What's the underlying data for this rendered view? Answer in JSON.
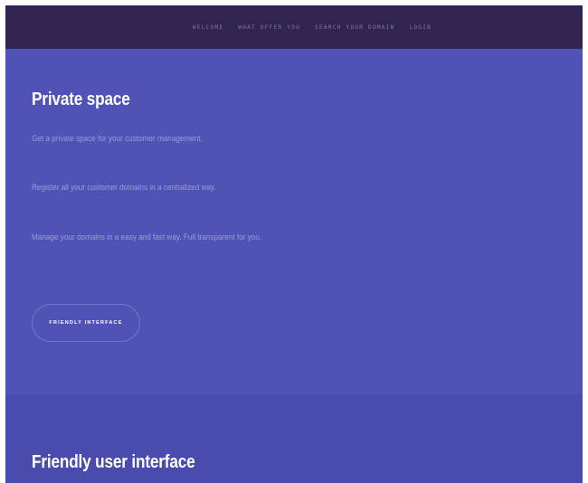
{
  "nav": {
    "items": [
      {
        "label": "WELCOME"
      },
      {
        "label": "WHAT OFFER YOU"
      },
      {
        "label": "SEARCH YOUR DOMAIN"
      },
      {
        "label": "LOGIN"
      }
    ]
  },
  "hero": {
    "title": "Private space",
    "paragraphs": [
      "Get a private space for your customer management.",
      "Register all your customer domains in a centralized way.",
      "Manage your domains in a easy and fast way. Full transparent for you."
    ],
    "button_label": "FRIENDLY INTERFACE"
  },
  "next_section": {
    "title": "Friendly user interface"
  },
  "colors": {
    "navbar_bg": "#312450",
    "section_bg": "#5052b5",
    "section_alt_bg": "#4a4cad",
    "text_primary": "#ffffff"
  }
}
